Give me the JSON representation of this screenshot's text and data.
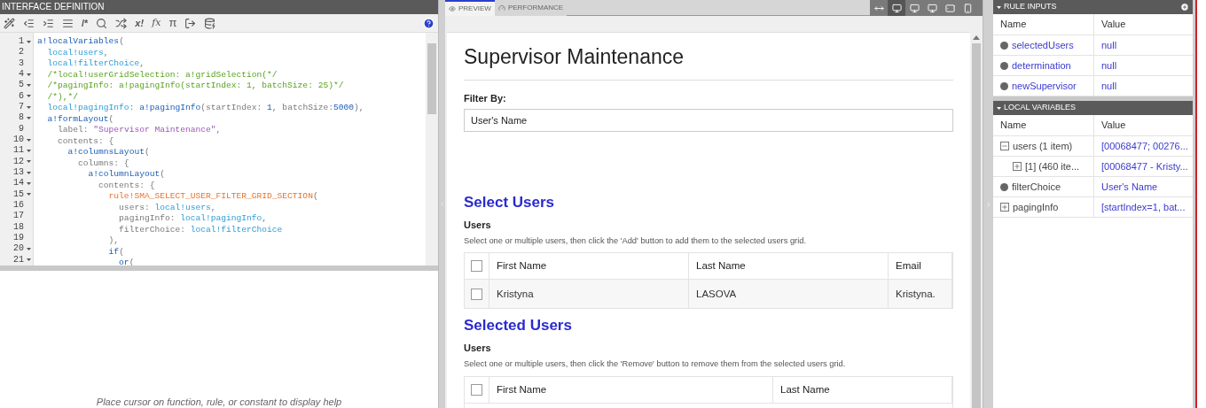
{
  "editor": {
    "title": "INTERFACE DEFINITION",
    "toolbar_glyphs": {
      "comment": "/*",
      "bang": "x!",
      "function": "fx",
      "pi": "π"
    },
    "lines": [
      {
        "n": "1",
        "fold": true,
        "tokens": [
          {
            "kind": "fn",
            "text": "a!localVariables"
          },
          {
            "kind": "plain",
            "text": "("
          }
        ]
      },
      {
        "n": "2",
        "fold": false,
        "tokens": [
          {
            "kind": "var",
            "text": "  local!users"
          },
          {
            "kind": "plain",
            "text": ","
          }
        ]
      },
      {
        "n": "3",
        "fold": false,
        "tokens": [
          {
            "kind": "var",
            "text": "  local!filterChoice"
          },
          {
            "kind": "plain",
            "text": ","
          }
        ]
      },
      {
        "n": "4",
        "fold": true,
        "tokens": [
          {
            "kind": "comment",
            "text": "  /*local!userGridSelection: a!gridSelection(*/"
          }
        ]
      },
      {
        "n": "5",
        "fold": true,
        "tokens": [
          {
            "kind": "comment",
            "text": "  /*pagingInfo: a!pagingInfo(startIndex: 1, batchSize: 25)*/"
          }
        ]
      },
      {
        "n": "6",
        "fold": true,
        "tokens": [
          {
            "kind": "comment",
            "text": "  /*),*/"
          }
        ]
      },
      {
        "n": "7",
        "fold": true,
        "tokens": [
          {
            "kind": "var",
            "text": "  local!pagingInfo"
          },
          {
            "kind": "plain",
            "text": ": "
          },
          {
            "kind": "fn",
            "text": "a!pagingInfo"
          },
          {
            "kind": "plain",
            "text": "(startIndex: "
          },
          {
            "kind": "num",
            "text": "1"
          },
          {
            "kind": "plain",
            "text": ", batchSize:"
          },
          {
            "kind": "num",
            "text": "5000"
          },
          {
            "kind": "plain",
            "text": "),"
          }
        ]
      },
      {
        "n": "8",
        "fold": true,
        "tokens": [
          {
            "kind": "fn",
            "text": "  a!formLayout"
          },
          {
            "kind": "plain",
            "text": "("
          }
        ]
      },
      {
        "n": "9",
        "fold": false,
        "tokens": [
          {
            "kind": "plain",
            "text": "    label: "
          },
          {
            "kind": "str",
            "text": "\"Supervisor Maintenance\""
          },
          {
            "kind": "plain",
            "text": ","
          }
        ]
      },
      {
        "n": "10",
        "fold": true,
        "tokens": [
          {
            "kind": "plain",
            "text": "    contents: {"
          }
        ]
      },
      {
        "n": "11",
        "fold": true,
        "tokens": [
          {
            "kind": "fn",
            "text": "      a!columnsLayout"
          },
          {
            "kind": "plain",
            "text": "("
          }
        ]
      },
      {
        "n": "12",
        "fold": true,
        "tokens": [
          {
            "kind": "plain",
            "text": "        columns: {"
          }
        ]
      },
      {
        "n": "13",
        "fold": true,
        "tokens": [
          {
            "kind": "fn",
            "text": "          a!columnLayout"
          },
          {
            "kind": "plain",
            "text": "("
          }
        ]
      },
      {
        "n": "14",
        "fold": true,
        "tokens": [
          {
            "kind": "plain",
            "text": "            contents: {"
          }
        ]
      },
      {
        "n": "15",
        "fold": true,
        "tokens": [
          {
            "kind": "rule",
            "text": "              rule!SMA_SELECT_USER_FILTER_GRID_SECTION"
          },
          {
            "kind": "plain",
            "text": "("
          }
        ]
      },
      {
        "n": "16",
        "fold": false,
        "tokens": [
          {
            "kind": "plain",
            "text": "                users: "
          },
          {
            "kind": "var",
            "text": "local!users"
          },
          {
            "kind": "plain",
            "text": ","
          }
        ]
      },
      {
        "n": "17",
        "fold": false,
        "tokens": [
          {
            "kind": "plain",
            "text": "                pagingInfo: "
          },
          {
            "kind": "var",
            "text": "local!pagingInfo"
          },
          {
            "kind": "plain",
            "text": ","
          }
        ]
      },
      {
        "n": "18",
        "fold": false,
        "tokens": [
          {
            "kind": "plain",
            "text": "                filterChoice: "
          },
          {
            "kind": "var",
            "text": "local!filterChoice"
          }
        ]
      },
      {
        "n": "19",
        "fold": false,
        "tokens": [
          {
            "kind": "plain",
            "text": "              ),"
          }
        ]
      },
      {
        "n": "20",
        "fold": true,
        "tokens": [
          {
            "kind": "fn",
            "text": "              if"
          },
          {
            "kind": "plain",
            "text": "("
          }
        ]
      },
      {
        "n": "21",
        "fold": true,
        "tokens": [
          {
            "kind": "fn",
            "text": "                or"
          },
          {
            "kind": "plain",
            "text": "("
          }
        ]
      }
    ],
    "help_text": "Place cursor on function, rule, or constant to display help"
  },
  "preview": {
    "tabs": [
      {
        "label": "PREVIEW",
        "selected": true
      },
      {
        "label": "PERFORMANCE",
        "selected": false
      }
    ],
    "devices": [
      {
        "selected": false
      },
      {
        "selected": true
      },
      {
        "selected": false
      },
      {
        "selected": false
      },
      {
        "selected": false
      },
      {
        "selected": false
      }
    ],
    "title": "Supervisor Maintenance",
    "filter": {
      "label": "Filter By:",
      "value": "User's Name"
    },
    "sections": [
      {
        "heading": "Select Users",
        "grid_label": "Users",
        "instructions": "Select one or multiple users, then click the 'Add' button to add them to the selected users grid.",
        "columns": [
          "First Name",
          "Last Name",
          "Email"
        ],
        "header_checked": false,
        "rows": [
          {
            "checked": false,
            "cells": [
              "Kristyna",
              "LASOVA",
              "Kristyna."
            ]
          }
        ]
      },
      {
        "heading": "Selected Users",
        "grid_label": "Users",
        "instructions": "Select one or multiple users, then click the 'Remove' button to remove them from the selected users grid.",
        "columns": [
          "First Name",
          "Last Name"
        ],
        "header_checked": false
      }
    ]
  },
  "rule_inputs": {
    "title": "RULE INPUTS",
    "columns": [
      "Name",
      "Value"
    ],
    "rows": [
      {
        "name": "selectedUsers",
        "value": "null"
      },
      {
        "name": "determination",
        "value": "null"
      },
      {
        "name": "newSupervisor",
        "value": "null"
      }
    ]
  },
  "local_variables": {
    "title": "LOCAL VARIABLES",
    "columns": [
      "Name",
      "Value"
    ],
    "items": [
      {
        "kind": "node",
        "expanded": true,
        "name": "users (1 item)",
        "value": "[00068477; 00276...",
        "children": [
          {
            "kind": "node",
            "expanded": false,
            "name": "[1] (460 ite...",
            "value": "[00068477 - Kristy..."
          }
        ]
      },
      {
        "kind": "value",
        "name": "filterChoice",
        "value": "User's Name"
      },
      {
        "kind": "node",
        "expanded": false,
        "name": "pagingInfo",
        "value": "[startIndex=1, bat..."
      }
    ]
  }
}
